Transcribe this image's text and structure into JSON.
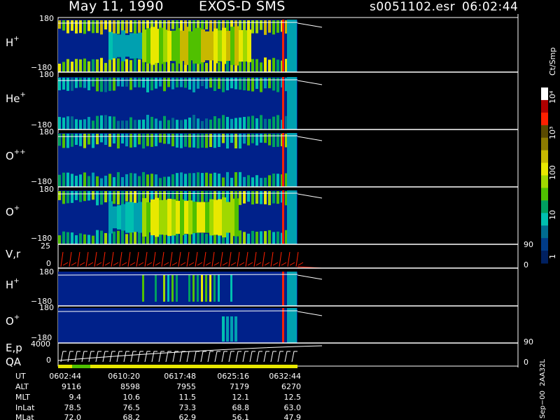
{
  "header": {
    "date": "May 11, 1990",
    "instrument": "EXOS-D SMS",
    "file": "s0051102.esr",
    "time": "06:02:44"
  },
  "panels": [
    {
      "id": "h_plus",
      "ion": "H",
      "charge": "+",
      "top_tick": "180",
      "bottom_tick": "−180"
    },
    {
      "id": "he_plus",
      "ion": "He",
      "charge": "+",
      "top_tick": "180",
      "bottom_tick": "−180"
    },
    {
      "id": "o_plusplus",
      "ion": "O",
      "charge": "++",
      "top_tick": "180",
      "bottom_tick": "−180"
    },
    {
      "id": "o_plus",
      "ion": "O",
      "charge": "+",
      "top_tick": "180",
      "bottom_tick": "−180"
    },
    {
      "id": "vr",
      "ion": "V,r",
      "charge": "",
      "top_tick": "25",
      "bottom_tick": "0",
      "right_top": "90",
      "right_bottom": "0"
    },
    {
      "id": "h_plus_2",
      "ion": "H",
      "charge": "+",
      "top_tick": "180",
      "bottom_tick": "−180"
    },
    {
      "id": "o_plus_2",
      "ion": "O",
      "charge": "+",
      "top_tick": "180",
      "bottom_tick": "−180"
    },
    {
      "id": "ep",
      "ion": "E,p",
      "charge": "",
      "top_tick": "4000",
      "bottom_tick": "0",
      "right_top": "90",
      "right_bottom": "0"
    }
  ],
  "qa_label": "QA",
  "colorbar": {
    "unit": "Ct/Smp",
    "labels": [
      "10⁴",
      "10³",
      "100",
      "10",
      "1"
    ],
    "colors": [
      "#ffffff",
      "#b00000",
      "#ff2000",
      "#5a4a00",
      "#8c7a00",
      "#c8b800",
      "#e8e800",
      "#a0d800",
      "#50c000",
      "#00a060",
      "#00c0b0",
      "#006c90",
      "#003c88",
      "#002060"
    ]
  },
  "time_table": {
    "rows": [
      {
        "label": "UT",
        "values": [
          "0602:44",
          "0610:20",
          "0617:48",
          "0625:16",
          "0632:44"
        ]
      },
      {
        "label": "ALT",
        "values": [
          "9116",
          "8598",
          "7955",
          "7179",
          "6270"
        ]
      },
      {
        "label": "MLT",
        "values": [
          "9.4",
          "10.6",
          "11.5",
          "12.1",
          "12.5"
        ]
      },
      {
        "label": "InLat",
        "values": [
          "78.5",
          "76.5",
          "73.3",
          "68.8",
          "63.0"
        ]
      },
      {
        "label": "MLat",
        "values": [
          "72.0",
          "68.2",
          "62.9",
          "56.1",
          "47.9"
        ]
      }
    ]
  },
  "footer_tag": "Sep−00  2AA32L",
  "chart_data": {
    "type": "heatmap",
    "title": "May 11, 1990   EXOS-D SMS",
    "x_ticks": [
      "0602:44",
      "0610:20",
      "0617:48",
      "0625:16",
      "0632:44"
    ],
    "y_range": [
      -180,
      180
    ],
    "color_scale": "log",
    "color_range": [
      1,
      10000
    ],
    "color_unit": "Ct/Smp",
    "series": [
      {
        "name": "H+",
        "type": "spectrogram",
        "y_range": [
          -180,
          180
        ]
      },
      {
        "name": "He+",
        "type": "spectrogram",
        "y_range": [
          -180,
          180
        ]
      },
      {
        "name": "O++",
        "type": "spectrogram",
        "y_range": [
          -180,
          180
        ]
      },
      {
        "name": "O+",
        "type": "spectrogram",
        "y_range": [
          -180,
          180
        ]
      },
      {
        "name": "V,r",
        "type": "line",
        "y_range": [
          0,
          25
        ],
        "y2_range": [
          0,
          90
        ]
      },
      {
        "name": "H+",
        "type": "spectrogram",
        "y_range": [
          -180,
          180
        ]
      },
      {
        "name": "O+",
        "type": "spectrogram",
        "y_range": [
          -180,
          180
        ]
      },
      {
        "name": "E,p",
        "type": "line",
        "y_range": [
          0,
          4000
        ],
        "y2_range": [
          0,
          90
        ]
      }
    ]
  }
}
